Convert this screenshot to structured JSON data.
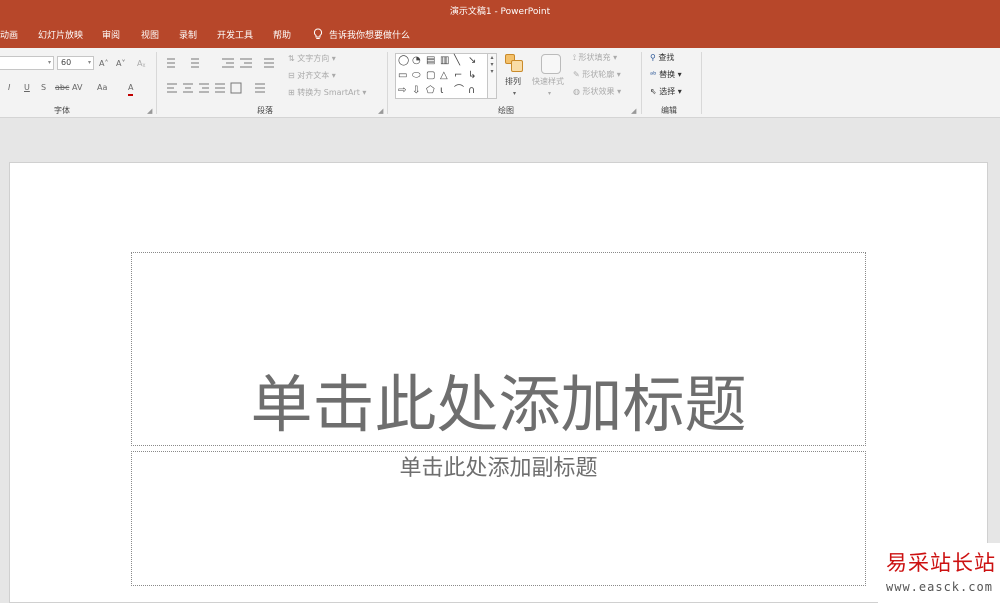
{
  "window": {
    "title": "演示文稿1  -  PowerPoint"
  },
  "tabs": [
    {
      "label": "动画"
    },
    {
      "label": "幻灯片放映"
    },
    {
      "label": "审阅"
    },
    {
      "label": "视图"
    },
    {
      "label": "录制"
    },
    {
      "label": "开发工具"
    },
    {
      "label": "帮助"
    }
  ],
  "tell_me": {
    "label": "告诉我你想要做什么",
    "icon": "lightbulb-icon"
  },
  "ribbon": {
    "font": {
      "size_value": "60",
      "increase_size": "A˄",
      "decrease_size": "A˅",
      "clear_format": "Aᵪ",
      "italic": "I",
      "underline": "U",
      "shadow": "S",
      "strikethrough": "abc",
      "char_spacing": "AV",
      "change_case": "Aa",
      "font_color": "A",
      "label": "字体"
    },
    "paragraph": {
      "text_direction": "文字方向",
      "align_text": "对齐文本",
      "convert_smartart": "转换为 SmartArt",
      "label": "段落"
    },
    "drawing": {
      "arrange": "排列",
      "quick_styles": "快速样式",
      "shape_fill": "形状填充",
      "shape_outline": "形状轮廓",
      "shape_effects": "形状效果",
      "label": "绘图"
    },
    "editing": {
      "find": "查找",
      "replace": "替换",
      "select": "选择",
      "label": "编辑"
    }
  },
  "slide": {
    "title_placeholder": "单击此处添加标题",
    "subtitle_placeholder": "单击此处添加副标题"
  },
  "watermark": {
    "brand": "易采站长站",
    "url": "www.easck.com"
  },
  "colors": {
    "accent": "#b7472a",
    "ribbon_bg": "#f3f3f3",
    "stage_bg": "#e6e6e6",
    "placeholder_text": "#6e6e6e"
  }
}
